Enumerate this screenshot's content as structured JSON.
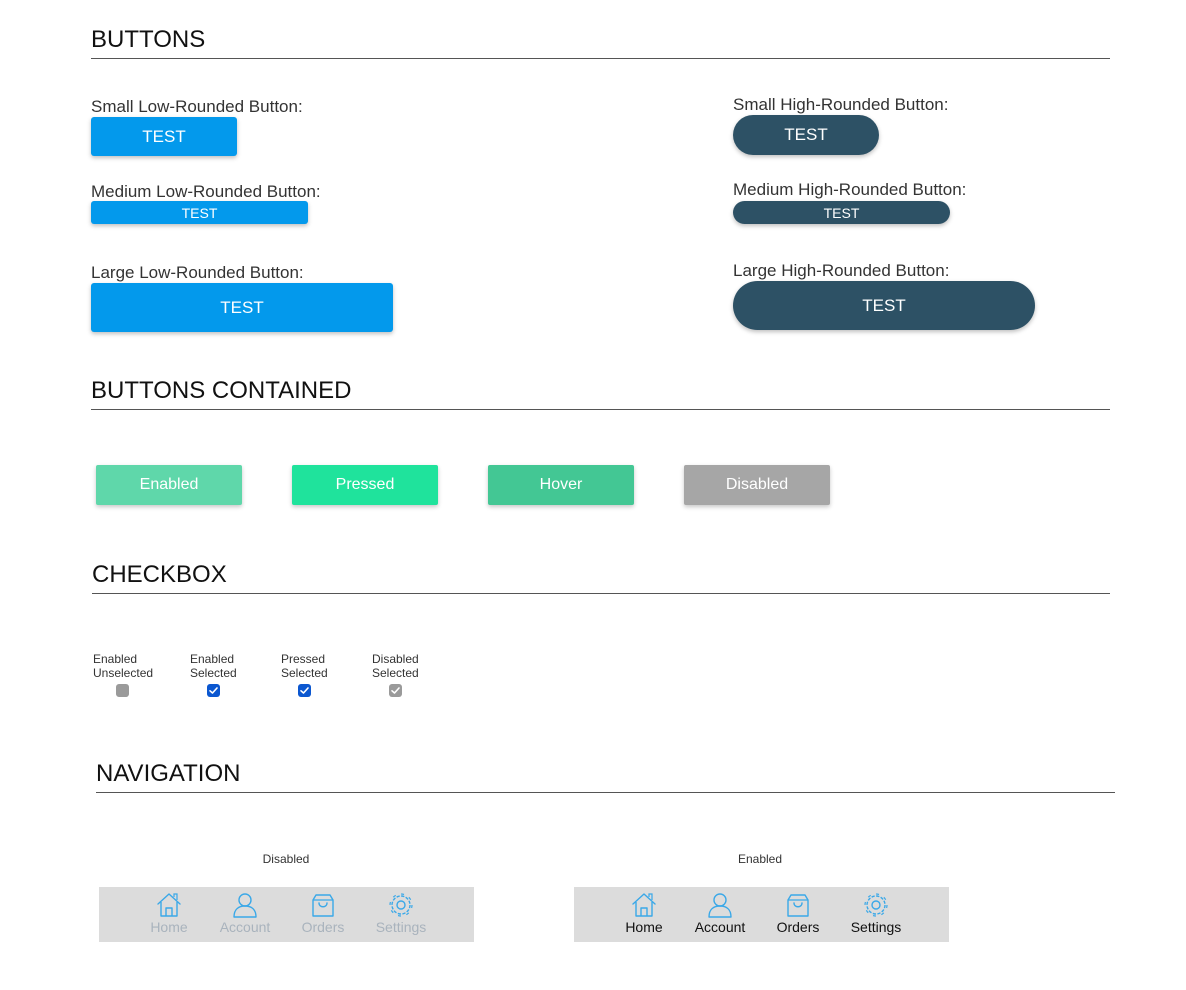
{
  "sections": {
    "buttons": "BUTTONS",
    "contained": "BUTTONS CONTAINED",
    "checkbox": "CHECKBOX",
    "navigation": "NAVIGATION"
  },
  "buttons": {
    "small_low": {
      "label": "Small Low-Rounded Button:",
      "text": "TEST"
    },
    "medium_low": {
      "label": "Medium Low-Rounded Button:",
      "text": "TEST"
    },
    "large_low": {
      "label": "Large Low-Rounded Button:",
      "text": "TEST"
    },
    "small_high": {
      "label": "Small High-Rounded Button:",
      "text": "TEST"
    },
    "medium_high": {
      "label": "Medium High-Rounded Button:",
      "text": "TEST"
    },
    "large_high": {
      "label": "Large High-Rounded Button:",
      "text": "TEST"
    }
  },
  "contained": {
    "enabled": {
      "text": "Enabled",
      "color": "#5fd7aa"
    },
    "pressed": {
      "text": "Pressed",
      "color": "#1fe39c"
    },
    "hover": {
      "text": "Hover",
      "color": "#43c794"
    },
    "disabled": {
      "text": "Disabled",
      "color": "#a6a6a6"
    }
  },
  "checkboxes": {
    "enabled_unselected": {
      "line1": "Enabled",
      "line2": "Unselected",
      "checked": false
    },
    "enabled_selected": {
      "line1": "Enabled",
      "line2": "Selected",
      "checked": true
    },
    "pressed_selected": {
      "line1": "Pressed",
      "line2": "Selected",
      "checked": true
    },
    "disabled_selected": {
      "line1": "Disabled",
      "line2": "Selected",
      "checked": true
    }
  },
  "navigation": {
    "disabled": {
      "caption": "Disabled",
      "items": {
        "home": "Home",
        "account": "Account",
        "orders": "Orders",
        "settings": "Settings"
      }
    },
    "enabled": {
      "caption": "Enabled",
      "items": {
        "home": "Home",
        "account": "Account",
        "orders": "Orders",
        "settings": "Settings"
      }
    }
  },
  "colors": {
    "low_button": "#0399ec",
    "high_button": "#2d5165",
    "checkbox_checked": "#0b57d0",
    "checkbox_disabled": "#9a9a9a",
    "nav_icon": "#3aa8e8",
    "nav_bar": "#dcdcdc"
  },
  "icons": {
    "home": "home-icon",
    "account": "account-icon",
    "orders": "shopping-bag-icon",
    "settings": "gear-icon"
  }
}
